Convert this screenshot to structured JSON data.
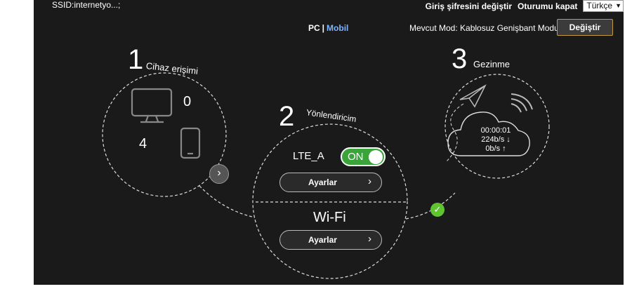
{
  "header": {
    "ssid": "SSID:internetyo...;",
    "change_password": "Giriş şifresini değiştir",
    "logout": "Oturumu kapat",
    "language": "Türkçe"
  },
  "view_switch": {
    "pc": "PC",
    "separator": "|",
    "mobile": "Mobil"
  },
  "mode": {
    "text": "Mevcut Mod: Kablosuz Genişbant Modu",
    "change_button": "Değiştir"
  },
  "step1": {
    "number": "1",
    "title": "Cihaz erişimi",
    "pc_count": "0",
    "mobile_count": "4"
  },
  "step2": {
    "number": "2",
    "title": "Yönlendiricim",
    "lte_label": "LTE_A",
    "toggle_state": "ON",
    "settings_label_lte": "Ayarlar",
    "wifi_label": "Wi-Fi",
    "settings_label_wifi": "Ayarlar"
  },
  "step3": {
    "number": "3",
    "title": "Gezinme",
    "duration": "00:00:01",
    "download": "224b/s ↓",
    "upload": "0b/s ↑"
  },
  "colors": {
    "background": "#1a1a1a",
    "toggle_on": "#3aa43a",
    "check": "#5fc42f",
    "link_active": "#7db4ff",
    "button_border": "#c49a3b"
  },
  "icons": [
    "monitor-icon",
    "phone-icon",
    "paper-plane-icon",
    "cloud-icon",
    "signal-waves-icon",
    "chevron-right-icon",
    "check-icon"
  ]
}
